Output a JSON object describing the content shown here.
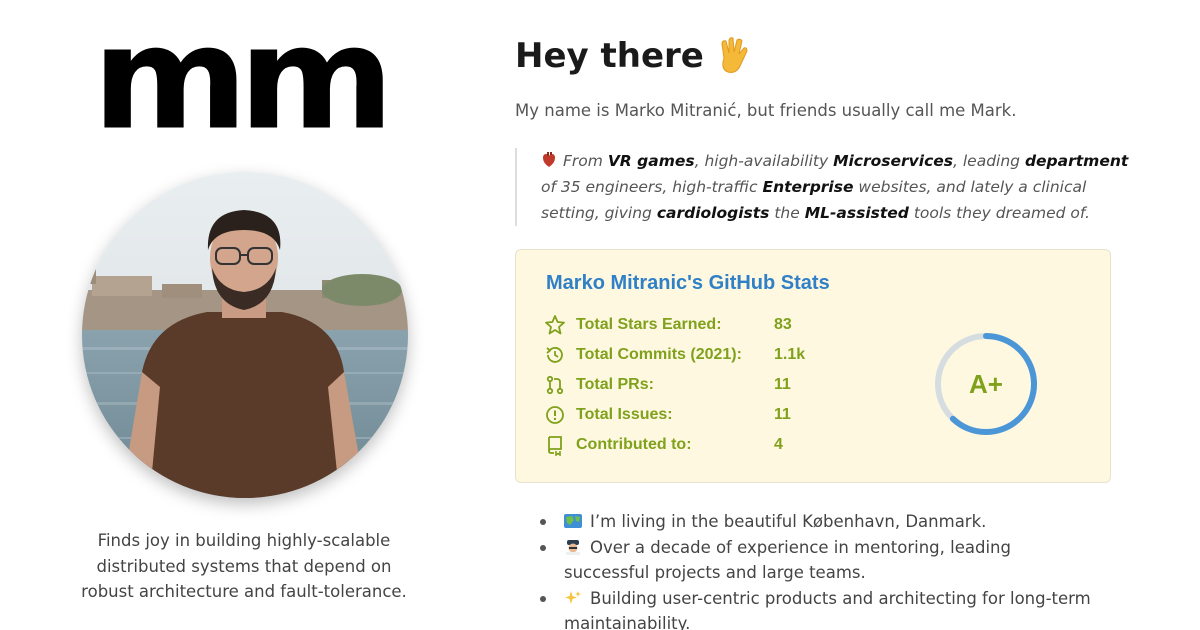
{
  "logo": {
    "text": "mm"
  },
  "avatar": {
    "icon": "profile-photo"
  },
  "tagline": "Finds joy in building highly-scalable distributed systems that depend on robust architecture and fault-tolerance.",
  "heading": {
    "text": "Hey there",
    "icon": "vulcan-salute-icon"
  },
  "intro": "My name is Marko Mitranić, but friends usually call me Mark.",
  "quote": {
    "icon": "anatomical-heart-icon",
    "parts": [
      {
        "t": "From ",
        "b": false
      },
      {
        "t": "VR games",
        "b": true
      },
      {
        "t": ", high-availability ",
        "b": false
      },
      {
        "t": "Microservices",
        "b": true
      },
      {
        "t": ", leading ",
        "b": false
      },
      {
        "t": "department",
        "b": true
      },
      {
        "t": " of 35 engineers, high-traffic ",
        "b": false
      },
      {
        "t": "Enterprise",
        "b": true
      },
      {
        "t": " websites, and lately a clinical setting, giving ",
        "b": false
      },
      {
        "t": "cardiologists",
        "b": true
      },
      {
        "t": " the ",
        "b": false
      },
      {
        "t": "ML-assisted",
        "b": true
      },
      {
        "t": " tools they dreamed of.",
        "b": false
      }
    ]
  },
  "stats": {
    "title": "Marko Mitranic's GitHub Stats",
    "rows": [
      {
        "icon": "star-icon",
        "label": "Total Stars Earned:",
        "value": "83"
      },
      {
        "icon": "history-icon",
        "label": "Total Commits (2021):",
        "value": "1.1k"
      },
      {
        "icon": "pull-request-icon",
        "label": "Total PRs:",
        "value": "11"
      },
      {
        "icon": "issue-icon",
        "label": "Total Issues:",
        "value": "11"
      },
      {
        "icon": "repo-icon",
        "label": "Contributed to:",
        "value": "4"
      }
    ],
    "grade": "A+",
    "grade_progress": 0.62,
    "colors": {
      "title": "#2f80c7",
      "text": "#7fa11c",
      "ring": "#4a96d6",
      "background": "#fff8e1"
    }
  },
  "bullets": [
    {
      "icon": "map-icon",
      "text": "I’m living in the beautiful København, Danmark."
    },
    {
      "icon": "pilot-icon",
      "text": "Over a decade of experience in mentoring, leading successful projects and large teams."
    },
    {
      "icon": "sparkles-icon",
      "text": "Building user-centric products and architecting for long-term maintainability."
    }
  ]
}
